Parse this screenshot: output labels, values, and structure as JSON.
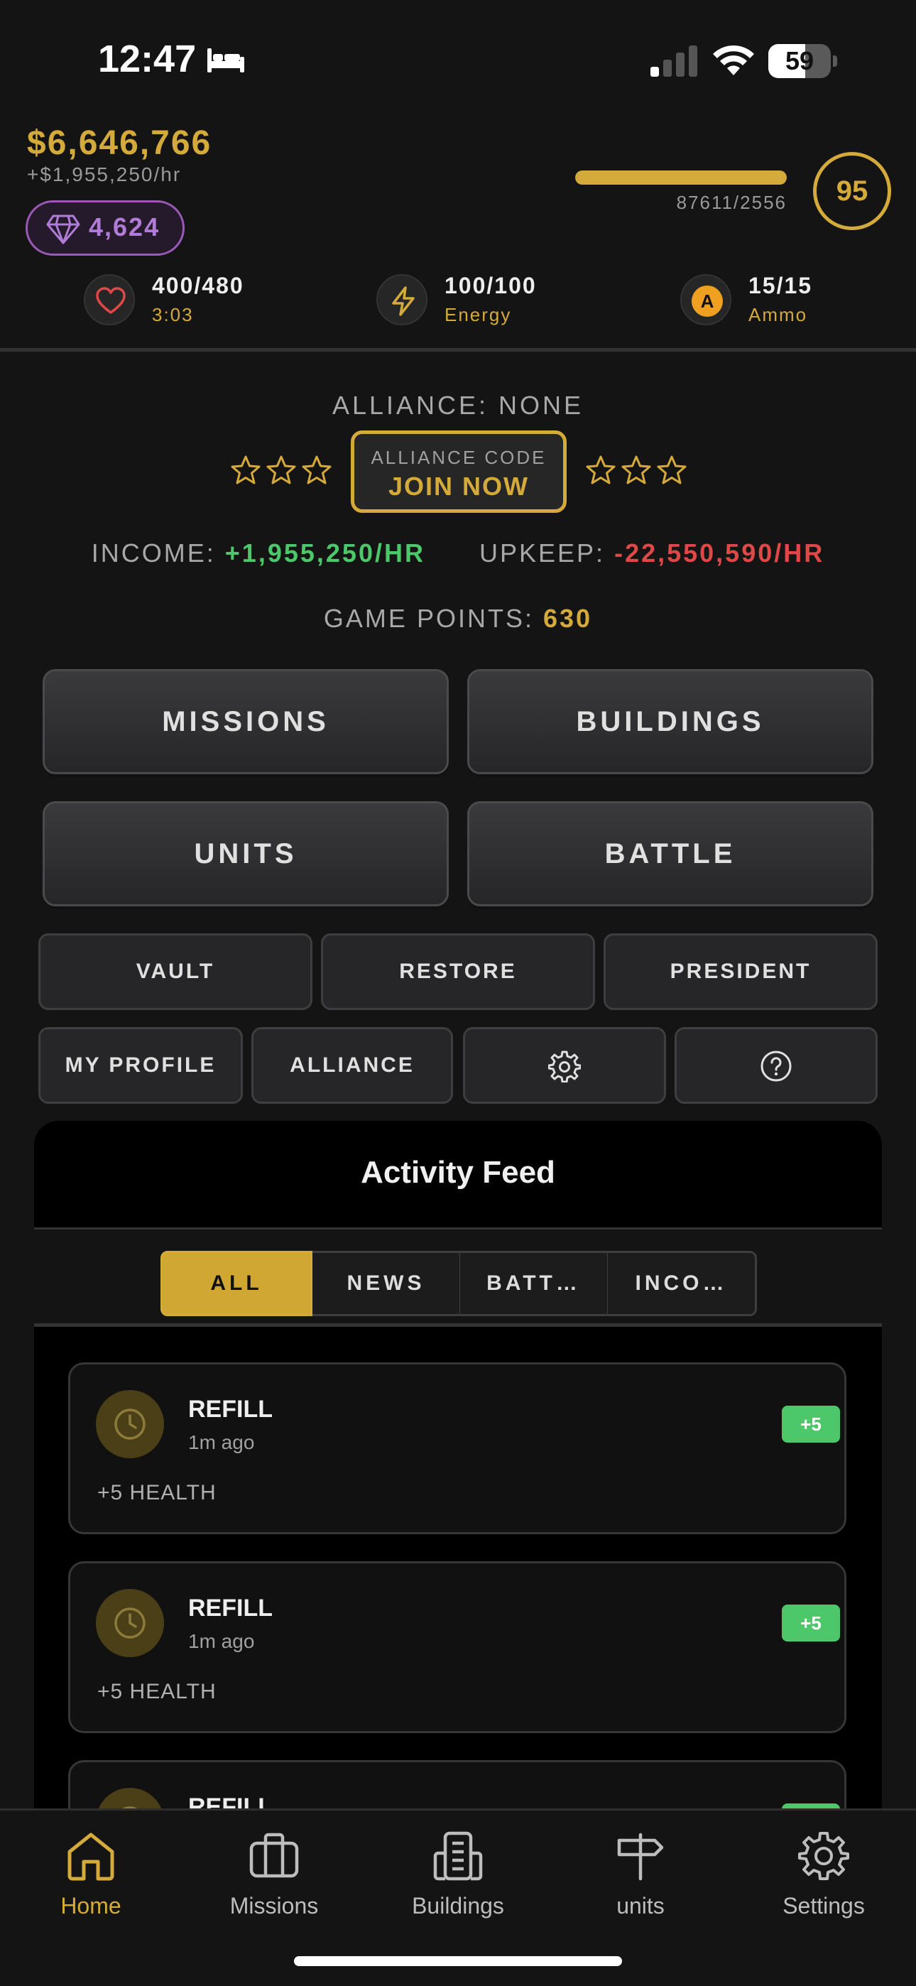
{
  "status_bar": {
    "time": "12:47",
    "battery": "59",
    "battery_level": 0.59,
    "bed_icon": "bed-icon",
    "signal_icon": "cellular-signal-icon",
    "wifi_icon": "wifi-icon"
  },
  "header": {
    "money": "$6,646,766",
    "money_rate": "+$1,955,250/hr",
    "gems": "4,624",
    "gem_icon": "diamond-icon",
    "xp_text": "87611/2556",
    "xp_progress": 1.0,
    "level": "95"
  },
  "stats": {
    "health": {
      "value": "400/480",
      "sub": "3:03",
      "icon": "heart-icon"
    },
    "energy": {
      "value": "100/100",
      "sub": "Energy",
      "icon": "lightning-icon"
    },
    "ammo": {
      "value": "15/15",
      "sub": "Ammo",
      "badge": "A"
    }
  },
  "alliance": {
    "title": "ALLIANCE: NONE",
    "code_label": "ALLIANCE CODE",
    "join_label": "JOIN NOW"
  },
  "economy": {
    "income_label": "INCOME:",
    "income_value": "+1,955,250/HR",
    "upkeep_label": "UPKEEP:",
    "upkeep_value": "-22,550,590/HR",
    "points_label": "GAME POINTS:",
    "points_value": "630"
  },
  "main_buttons": {
    "missions": "MISSIONS",
    "buildings": "BUILDINGS",
    "units": "UNITS",
    "battle": "BATTLE"
  },
  "secondary_buttons": {
    "vault": "VAULT",
    "restore": "RESTORE",
    "president": "PRESIDENT",
    "my_profile": "MY PROFILE",
    "alliance": "ALLIANCE",
    "settings_icon": "gear-icon",
    "help_icon": "question-circle-icon"
  },
  "feed": {
    "title": "Activity Feed",
    "tabs": [
      "ALL",
      "NEWS",
      "BATT…",
      "INCO…"
    ],
    "active_tab": "ALL",
    "items": [
      {
        "title": "REFILL",
        "time": "1m ago",
        "desc": "+5 HEALTH",
        "badge": "+5",
        "icon": "clock-icon"
      },
      {
        "title": "REFILL",
        "time": "1m ago",
        "desc": "+5 HEALTH",
        "badge": "+5",
        "icon": "clock-icon"
      },
      {
        "title": "REFILL",
        "time": "",
        "desc": "",
        "badge": "",
        "icon": "clock-icon"
      }
    ]
  },
  "nav": {
    "items": [
      {
        "label": "Home",
        "icon": "home-icon",
        "active": true
      },
      {
        "label": "Missions",
        "icon": "briefcase-icon",
        "active": false
      },
      {
        "label": "Buildings",
        "icon": "building-icon",
        "active": false
      },
      {
        "label": "units",
        "icon": "signpost-icon",
        "active": false
      },
      {
        "label": "Settings",
        "icon": "gear-icon",
        "active": false
      }
    ]
  },
  "colors": {
    "accent": "#d4aa3a",
    "gem": "#9b59b6",
    "income": "#4cc76a",
    "upkeep": "#e04848",
    "background": "#141414"
  }
}
